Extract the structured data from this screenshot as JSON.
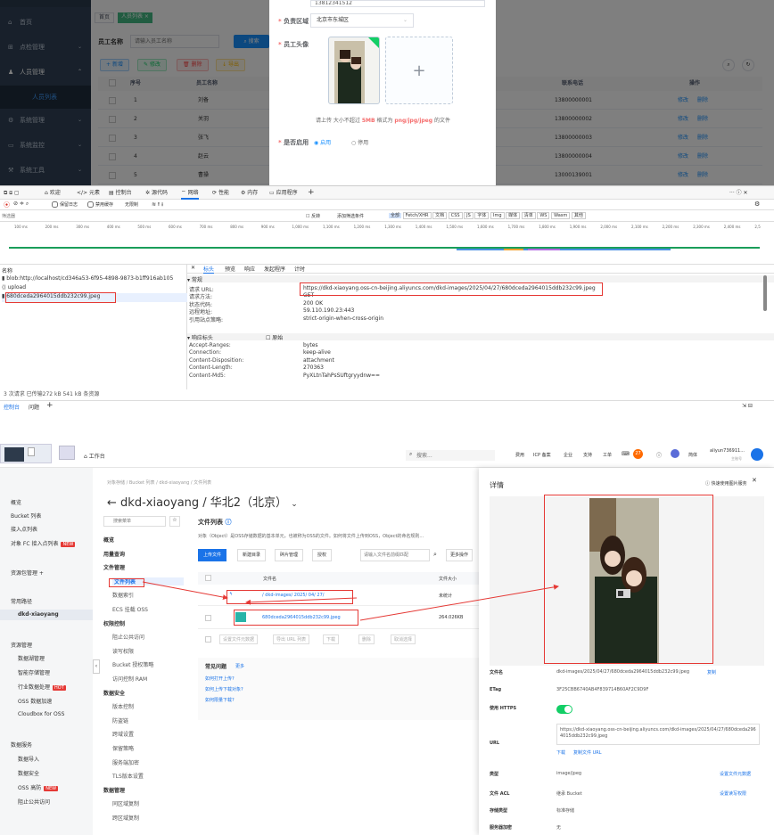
{
  "admin": {
    "sidebar": {
      "items": [
        {
          "label": "首页"
        },
        {
          "label": "点检管理"
        },
        {
          "label": "人员管理"
        },
        {
          "label": "人员列表"
        },
        {
          "label": "系统管理"
        },
        {
          "label": "系统监控"
        },
        {
          "label": "系统工具"
        }
      ]
    },
    "tabs": [
      "首页",
      "人员列表 ×"
    ],
    "search": {
      "label": "员工名称",
      "placeholder": "请输入员工名称",
      "button": "搜索"
    },
    "toolbar": [
      "新增",
      "修改",
      "删除",
      "导出"
    ],
    "table": {
      "columns": [
        "序号",
        "员工名称",
        "联系电话",
        "操作"
      ],
      "rows": [
        {
          "no": "1",
          "name": "刘备",
          "phone": "13800000001"
        },
        {
          "no": "2",
          "name": "关羽",
          "phone": "13800000002"
        },
        {
          "no": "3",
          "name": "张飞",
          "phone": "13800000003"
        },
        {
          "no": "4",
          "name": "赵云",
          "phone": "13800000004"
        },
        {
          "no": "5",
          "name": "曹操",
          "phone": "13000139001"
        }
      ],
      "actions": [
        "修改",
        "删除"
      ]
    },
    "modal": {
      "phone_value": "13812341512",
      "region_label": "负责区域",
      "region_value": "北京市东城区",
      "avatar_label": "员工头像",
      "upload_hint_prefix": "请上传 大小不超过",
      "upload_hint_size": "5MB",
      "upload_hint_mid": "格式为",
      "upload_hint_types": "png/jpg/jpeg",
      "upload_hint_suffix": "的文件",
      "enable_label": "是否启用",
      "enable_yes": "启用",
      "enable_no": "停用"
    }
  },
  "devtools": {
    "tabs": [
      "欢迎",
      "元素",
      "控制台",
      "源代码",
      "网络",
      "性能",
      "内存",
      "应用程序"
    ],
    "filter_placeholder": "筛选器",
    "filters": [
      "反转",
      "添加筛选条件",
      "全部",
      "Fetch/XHR",
      "文档",
      "CSS",
      "JS",
      "字体",
      "Img",
      "媒体",
      "清单",
      "WS",
      "Wasm",
      "其他"
    ],
    "options": [
      "保留日志",
      "禁用缓存",
      "无限制"
    ],
    "timeline_ticks": [
      "100 ms",
      "200 ms",
      "300 ms",
      "400 ms",
      "500 ms",
      "600 ms",
      "700 ms",
      "800 ms",
      "900 ms",
      "1,000 ms",
      "1,100 ms",
      "1,200 ms",
      "1,300 ms",
      "1,400 ms",
      "1,500 ms",
      "1,600 ms",
      "1,700 ms",
      "1,800 ms",
      "1,900 ms",
      "2,000 ms",
      "2,100 ms",
      "2,200 ms",
      "2,300 ms",
      "2,400 ms",
      "2,5"
    ],
    "name_header": "名称",
    "requests": [
      "blob:http://localhost/cd346a53-6f95-4898-9873-b1ff916ab105",
      "upload",
      "680dceda2964015ddb232c99.jpeg"
    ],
    "detail_tabs": [
      "标头",
      "预览",
      "响应",
      "发起程序",
      "计时"
    ],
    "general_title": "▾ 常规",
    "general": [
      {
        "k": "请求 URL:",
        "v": "https://dkd-xiaoyang.oss-cn-beijing.aliyuncs.com/dkd-images/2025/04/27/680dceda2964015ddb232c99.jpeg"
      },
      {
        "k": "请求方法:",
        "v": "GET"
      },
      {
        "k": "状态代码:",
        "v": "200 OK"
      },
      {
        "k": "远程地址:",
        "v": "59.110.190.23:443"
      },
      {
        "k": "引用站点策略:",
        "v": "strict-origin-when-cross-origin"
      }
    ],
    "response_title": "▾ 响应标头",
    "raw_label": "原始",
    "response": [
      {
        "k": "Accept-Ranges:",
        "v": "bytes"
      },
      {
        "k": "Connection:",
        "v": "keep-alive"
      },
      {
        "k": "Content-Disposition:",
        "v": "attachment"
      },
      {
        "k": "Content-Length:",
        "v": "270363"
      },
      {
        "k": "Content-Md5:",
        "v": "PyXLtnTahPsSUftgryydnw=="
      }
    ],
    "status_line": "3 次请求  已传输272 kB  541 kB 条资源",
    "bottom_tabs": [
      "控制台",
      "问题"
    ]
  },
  "aliyun": {
    "workbench": "工作台",
    "search_placeholder": "搜索...",
    "top_links": [
      "费用",
      "ICP 备案",
      "企业",
      "支持",
      "工单"
    ],
    "badge": "27",
    "lang": "简体",
    "user": "aliyun736911...",
    "user_sub": "主账号",
    "left_menu": [
      "概览",
      "Bucket 列表",
      "接入点列表",
      "对象 FC 接入点列表",
      "数据服务",
      "数据导入",
      "数据安全",
      "OSS 高防",
      "阻止公共访问"
    ],
    "left_menu_extra": [
      "资源包管理",
      "常用路径",
      "dkd-xiaoyang",
      "资源管理",
      "数据湖管理",
      "智能存储管理",
      "行业数据处理",
      "OSS 数据加速",
      "Cloudbox for OSS"
    ],
    "new_badge": "NEW",
    "hot_badge": "HOT",
    "breadcrumb": "对象存储 / Bucket 列表 / dkd-xiaoyang / 文件列表",
    "bucket_title": "dkd-xiaoyang / 华北2（北京）",
    "sub_search_placeholder": "搜索菜单",
    "sub_menu": [
      "概览",
      "用量查询",
      "文件管理",
      "文件列表",
      "数据索引",
      "ECS 挂载 OSS",
      "权限控制",
      "阻止公共访问",
      "读写权限",
      "Bucket 授权策略",
      "访问控制 RAM",
      "数据安全",
      "版本控制",
      "防盗链",
      "跨域设置",
      "保留策略",
      "服务端加密",
      "TLS版本设置",
      "数据管理",
      "同区域复制",
      "跨区域复制"
    ],
    "file_list_title": "文件列表",
    "file_list_desc": "对象（Object）是OSS存储数据的基本单元，也被称为OSS的文件。如何将文件上传到OSS，Object的命名规则...",
    "buttons": [
      "上传文件",
      "新建目录",
      "碎片管理",
      "授权"
    ],
    "file_search_placeholder": "请输入文件名前缀匹配",
    "more_ops": "更多操作",
    "cols": [
      "文件名",
      "文件大小"
    ],
    "path": "/ dkd-images/ 2025/ 04/ 27/",
    "path_size": "未统计",
    "file_name": "680dceda2964015ddb232c99.jpeg",
    "file_size": "264.026KB",
    "bulk_ops": [
      "设置文件元数据",
      "导出 URL 列表",
      "下载",
      "删除",
      "取消选择"
    ],
    "faq_title": "常见问题",
    "faq_more": "更多",
    "faq": [
      "如何打开上传?",
      "如何上传下载对象?",
      "如何限量下载?"
    ],
    "detail": {
      "title": "详情",
      "quick_link": "快速使用图片服务",
      "fields": [
        {
          "k": "文件名",
          "v": "dkd-images/2025/04/27/680dceda2964015ddb232c99.jpeg",
          "link": "复制"
        },
        {
          "k": "ETag",
          "v": "3F25CBB6740AB4F839714B60AF2C9D9F",
          "link": ""
        },
        {
          "k": "使用 HTTPS",
          "v": "",
          "link": ""
        },
        {
          "k": "URL",
          "v": "https://dkd-xiaoyang.oss-cn-beijing.aliyuncs.com/dkd-images/2025/04/27/680dceda2964015ddb232c99.jpeg",
          "link": ""
        },
        {
          "k": "类型",
          "v": "image/jpeg",
          "link": "设置文件元数据"
        },
        {
          "k": "文件 ACL",
          "v": "继承 Bucket",
          "link": "设置读写权限"
        },
        {
          "k": "存储类型",
          "v": "标准存储",
          "link": ""
        },
        {
          "k": "服务器加密",
          "v": "无",
          "link": ""
        }
      ],
      "url_actions": [
        "下载",
        "复制文件 URL"
      ]
    }
  }
}
